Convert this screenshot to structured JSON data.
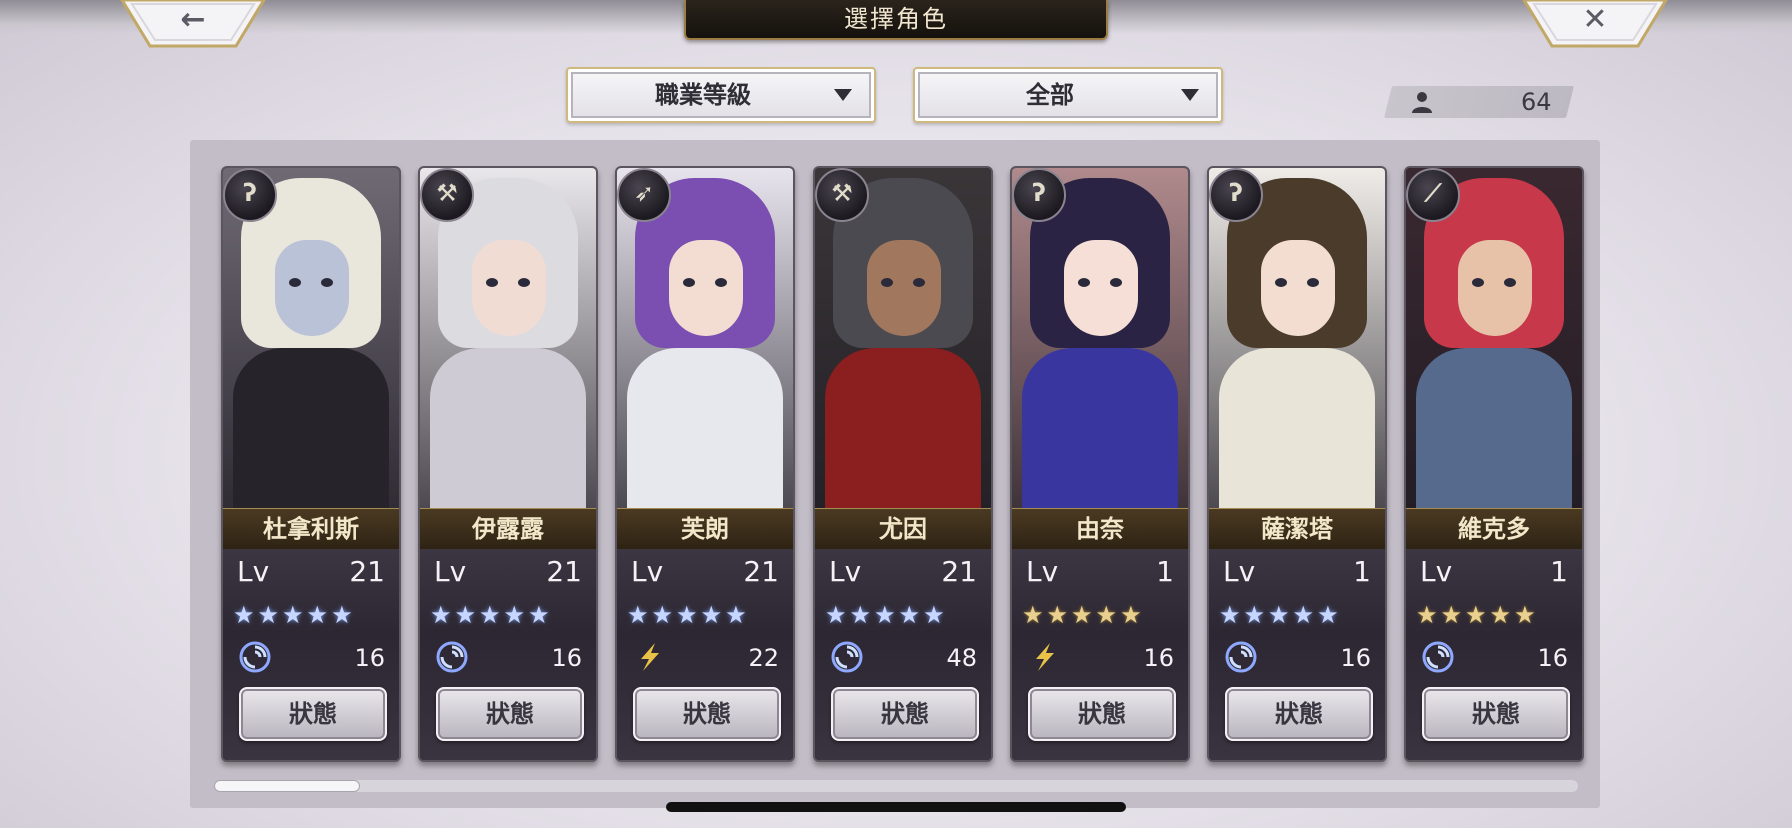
{
  "header": {
    "title": "選擇角色",
    "back_glyph": "←",
    "close_glyph": "✕"
  },
  "filters": {
    "sort_label": "職業等級",
    "scope_label": "全部"
  },
  "roster": {
    "count": "64"
  },
  "status_label": "狀態",
  "level_label": "Lv",
  "colors": {
    "accent_gold": "#b39a5e",
    "star_blue": "#c6d6ff",
    "star_gold": "#e9d08e"
  },
  "cards": [
    {
      "name": "杜拿利斯",
      "level": "21",
      "stars": "★★★★★",
      "star_color": "blue",
      "element": "wind-swirl-icon",
      "element_value": "16",
      "class_icon": "staff-icon"
    },
    {
      "name": "伊露露",
      "level": "21",
      "stars": "★★★★★",
      "star_color": "blue",
      "element": "wind-swirl-icon",
      "element_value": "16",
      "class_icon": "axe-icon"
    },
    {
      "name": "芙朗",
      "level": "21",
      "stars": "★★★★★",
      "star_color": "blue",
      "element": "lightning-icon",
      "element_value": "22",
      "class_icon": "arrow-icon"
    },
    {
      "name": "尤因",
      "level": "21",
      "stars": "★★★★★",
      "star_color": "blue",
      "element": "wind-swirl-icon",
      "element_value": "48",
      "class_icon": "hammer-icon"
    },
    {
      "name": "由奈",
      "level": "1",
      "stars": "★★★★★",
      "star_color": "gold",
      "element": "lightning-icon",
      "element_value": "16",
      "class_icon": "staff-icon"
    },
    {
      "name": "薩潔塔",
      "level": "1",
      "stars": "★★★★★",
      "star_color": "blue",
      "element": "wind-swirl-icon",
      "element_value": "16",
      "class_icon": "staff-icon"
    },
    {
      "name": "維克多",
      "level": "1",
      "stars": "★★★★★",
      "star_color": "gold",
      "element": "wind-swirl-icon",
      "element_value": "16",
      "class_icon": "sword-icon"
    }
  ]
}
